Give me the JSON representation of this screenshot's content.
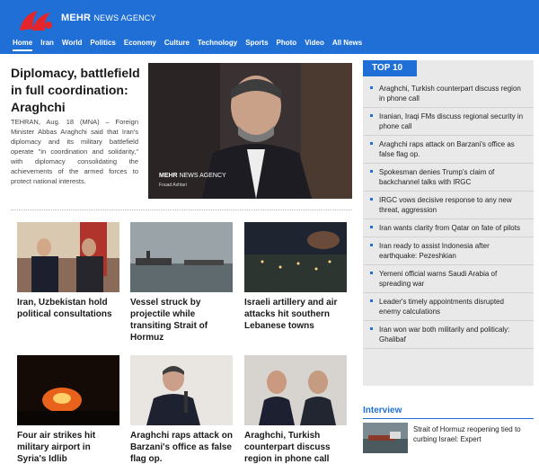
{
  "brand": {
    "name": "MEHR",
    "tagline": "NEWS AGENCY",
    "primary_color": "#1f6fd6",
    "logo_color": "#e4252b"
  },
  "nav": {
    "items": [
      "Home",
      "Iran",
      "World",
      "Politics",
      "Economy",
      "Culture",
      "Technology",
      "Sports",
      "Photo",
      "Video",
      "All News"
    ],
    "active": "Home"
  },
  "lead": {
    "title": "Diplomacy, battlefield in full coordination: Araghchi",
    "summary": "TEHRAN, Aug. 18 (MNA) – Foreign Minister Abbas Araghchi said that Iran's diplomacy and its military battlefield operate \"in coordination and solidarity,\" with diplomacy consolidating the achievements of the armed forces to protect national interests.",
    "photo_tag_main": "MEHR",
    "photo_tag_sub": "NEWS AGENCY",
    "photo_credit": "Fouad Ashtari"
  },
  "cards": [
    {
      "title": "Iran, Uzbekistan hold political consultations"
    },
    {
      "title": "Vessel struck by projectile while transiting Strait of Hormuz"
    },
    {
      "title": "Israeli artillery and air attacks hit southern Lebanese towns"
    },
    {
      "title": "Four air strikes hit military airport in Syria's Idlib"
    },
    {
      "title": "Araghchi raps attack on Barzani's office as false flag op."
    },
    {
      "title": "Araghchi, Turkish counterpart discuss region in phone call"
    }
  ],
  "top10": {
    "heading": "TOP 10",
    "items": [
      "Araghchi, Turkish counterpart discuss region in phone call",
      "Iranian, Iraqi FMs discuss regional security in phone call",
      "Araghchi raps attack on Barzani's office as false flag op.",
      "Spokesman denies Trump's claim of backchannel talks with IRGC",
      "IRGC vows decisive response to any new threat, aggression",
      "Iran wants clarity from Qatar on fate of pilots",
      "Iran ready to assist Indonesia after earthquake: Pezeshkian",
      "Yemeni official warns Saudi Arabia of spreading war",
      "Leader's timely appointments disrupted enemy calculations",
      "Iran won war both militarily and politicaly: Ghalibaf"
    ]
  },
  "interview": {
    "heading": "Interview",
    "item": "Strait of Hormuz reopening tied to curbing Israel: Expert"
  }
}
